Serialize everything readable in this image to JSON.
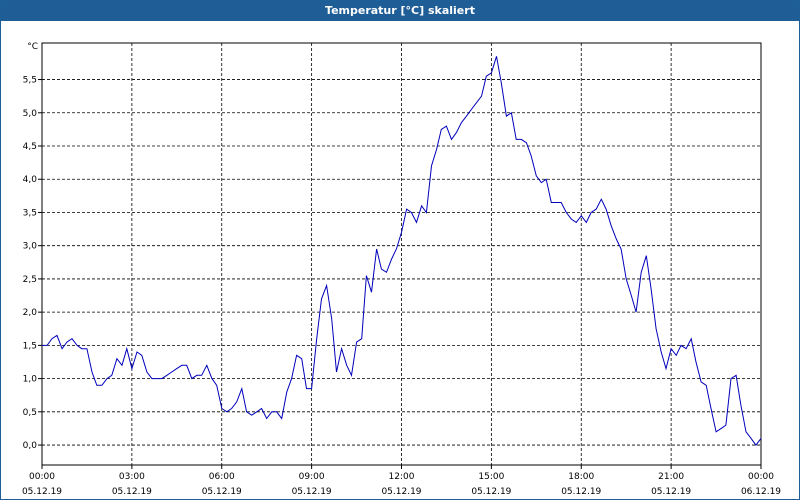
{
  "window": {
    "title": "Temperatur [°C] skaliert"
  },
  "chart_data": {
    "type": "line",
    "title": "Temperatur [°C] skaliert",
    "ylabel": "°C",
    "xlabel": "",
    "ylim": [
      -0.3,
      6.05
    ],
    "xlim": [
      0,
      24
    ],
    "y_ticks": [
      "0,0",
      "0,5",
      "1,0",
      "1,5",
      "2,0",
      "2,5",
      "3,0",
      "3,5",
      "4,0",
      "4,5",
      "5,0",
      "5,5"
    ],
    "x_ticks": [
      {
        "time": "00:00",
        "date": "05.12.19"
      },
      {
        "time": "03:00",
        "date": "05.12.19"
      },
      {
        "time": "06:00",
        "date": "05.12.19"
      },
      {
        "time": "09:00",
        "date": "05.12.19"
      },
      {
        "time": "12:00",
        "date": "05.12.19"
      },
      {
        "time": "15:00",
        "date": "05.12.19"
      },
      {
        "time": "18:00",
        "date": "05.12.19"
      },
      {
        "time": "21:00",
        "date": "05.12.19"
      },
      {
        "time": "00:00",
        "date": "06.12.19"
      }
    ],
    "grid": true,
    "series_color": "#0000bb",
    "series": [
      {
        "x": [
          0,
          0.17,
          0.33,
          0.5,
          0.67,
          0.83,
          1,
          1.17,
          1.33,
          1.5,
          1.67,
          1.83,
          2,
          2.17,
          2.33,
          2.5,
          2.67,
          2.83,
          3,
          3.17,
          3.33,
          3.5,
          3.67,
          3.83,
          4,
          4.17,
          4.33,
          4.5,
          4.67,
          4.83,
          5,
          5.17,
          5.33,
          5.5,
          5.67,
          5.83,
          6,
          6.17,
          6.33,
          6.5,
          6.67,
          6.83,
          7,
          7.17,
          7.33,
          7.5,
          7.67,
          7.83,
          8,
          8.17,
          8.33,
          8.5,
          8.67,
          8.83,
          9,
          9.17,
          9.33,
          9.5,
          9.67,
          9.83,
          10,
          10.17,
          10.33,
          10.5,
          10.67,
          10.83,
          11,
          11.17,
          11.33,
          11.5,
          11.67,
          11.83,
          12,
          12.17,
          12.33,
          12.5,
          12.67,
          12.83,
          13,
          13.17,
          13.33,
          13.5,
          13.67,
          13.83,
          14,
          14.17,
          14.33,
          14.5,
          14.67,
          14.83,
          15,
          15.17,
          15.33,
          15.5,
          15.67,
          15.83,
          16,
          16.17,
          16.33,
          16.5,
          16.67,
          16.83,
          17,
          17.17,
          17.33,
          17.5,
          17.67,
          17.83,
          18,
          18.17,
          18.33,
          18.5,
          18.67,
          18.83,
          19,
          19.17,
          19.33,
          19.5,
          19.67,
          19.83,
          20,
          20.17,
          20.33,
          20.5,
          20.67,
          20.83,
          21,
          21.17,
          21.33,
          21.5,
          21.67,
          21.83,
          22,
          22.17,
          22.33,
          22.5,
          22.67,
          22.83,
          23,
          23.17,
          23.33,
          23.5,
          23.67,
          23.83,
          24
        ],
        "y": [
          1.5,
          1.5,
          1.6,
          1.65,
          1.45,
          1.55,
          1.6,
          1.5,
          1.45,
          1.45,
          1.1,
          0.9,
          0.9,
          1.0,
          1.05,
          1.3,
          1.2,
          1.45,
          1.15,
          1.4,
          1.35,
          1.1,
          1.0,
          1.0,
          1.0,
          1.05,
          1.1,
          1.15,
          1.2,
          1.2,
          1.0,
          1.05,
          1.05,
          1.2,
          1.0,
          0.9,
          0.55,
          0.5,
          0.55,
          0.65,
          0.85,
          0.5,
          0.45,
          0.5,
          0.55,
          0.4,
          0.5,
          0.5,
          0.4,
          0.8,
          1.0,
          1.35,
          1.3,
          0.85,
          0.85,
          1.6,
          2.2,
          2.4,
          1.9,
          1.1,
          1.45,
          1.2,
          1.05,
          1.55,
          1.6,
          2.55,
          2.3,
          2.95,
          2.65,
          2.6,
          2.8,
          2.95,
          3.2,
          3.55,
          3.5,
          3.35,
          3.6,
          3.5,
          4.2,
          4.45,
          4.75,
          4.8,
          4.6,
          4.7,
          4.85,
          4.95,
          5.05,
          5.15,
          5.25,
          5.55,
          5.6,
          5.85,
          5.45,
          4.95,
          5.0,
          4.6,
          4.6,
          4.55,
          4.35,
          4.05,
          3.95,
          4.0,
          3.65,
          3.65,
          3.65,
          3.5,
          3.4,
          3.35,
          3.45,
          3.35,
          3.5,
          3.55,
          3.7,
          3.55,
          3.3,
          3.1,
          2.95,
          2.5,
          2.25,
          2.0,
          2.6,
          2.85,
          2.35,
          1.75,
          1.4,
          1.15,
          1.45,
          1.35,
          1.5,
          1.45,
          1.6,
          1.25,
          0.95,
          0.9,
          0.55,
          0.2,
          0.25,
          0.3,
          1.0,
          1.05,
          0.6,
          0.2,
          0.1,
          0.0,
          0.1
        ]
      }
    ]
  }
}
